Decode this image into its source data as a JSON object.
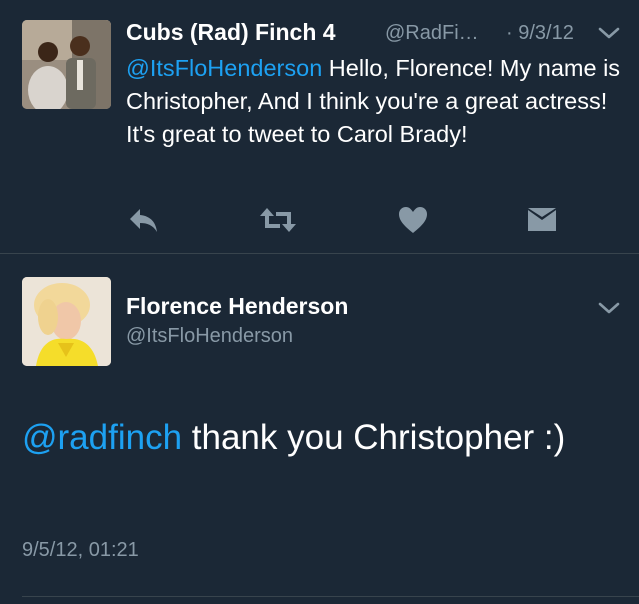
{
  "reply_tweet": {
    "display_name": "Cubs (Rad) Finch 4",
    "handle": "@RadFi…",
    "date": "· 9/3/12",
    "mention": "@ItsFloHenderson",
    "text": " Hello, Florence! My name is Christopher, And I think you're a great actress! It's great to tweet to Carol Brady!",
    "actions": [
      "reply-icon",
      "retweet-icon",
      "like-icon",
      "direct-message-icon"
    ],
    "avatar_icon": "profile-photo"
  },
  "main_tweet": {
    "display_name": "Florence Henderson",
    "handle": "@ItsFloHenderson",
    "mention": "@radfinch",
    "text": " thank you Christopher :)",
    "timestamp": "9/5/12, 01:21",
    "avatar_icon": "profile-photo"
  },
  "colors": {
    "background": "#1b2836",
    "link": "#1da1f2",
    "secondary_text": "#8899a6",
    "icon": "#8899a6",
    "divider": "#38444d"
  }
}
